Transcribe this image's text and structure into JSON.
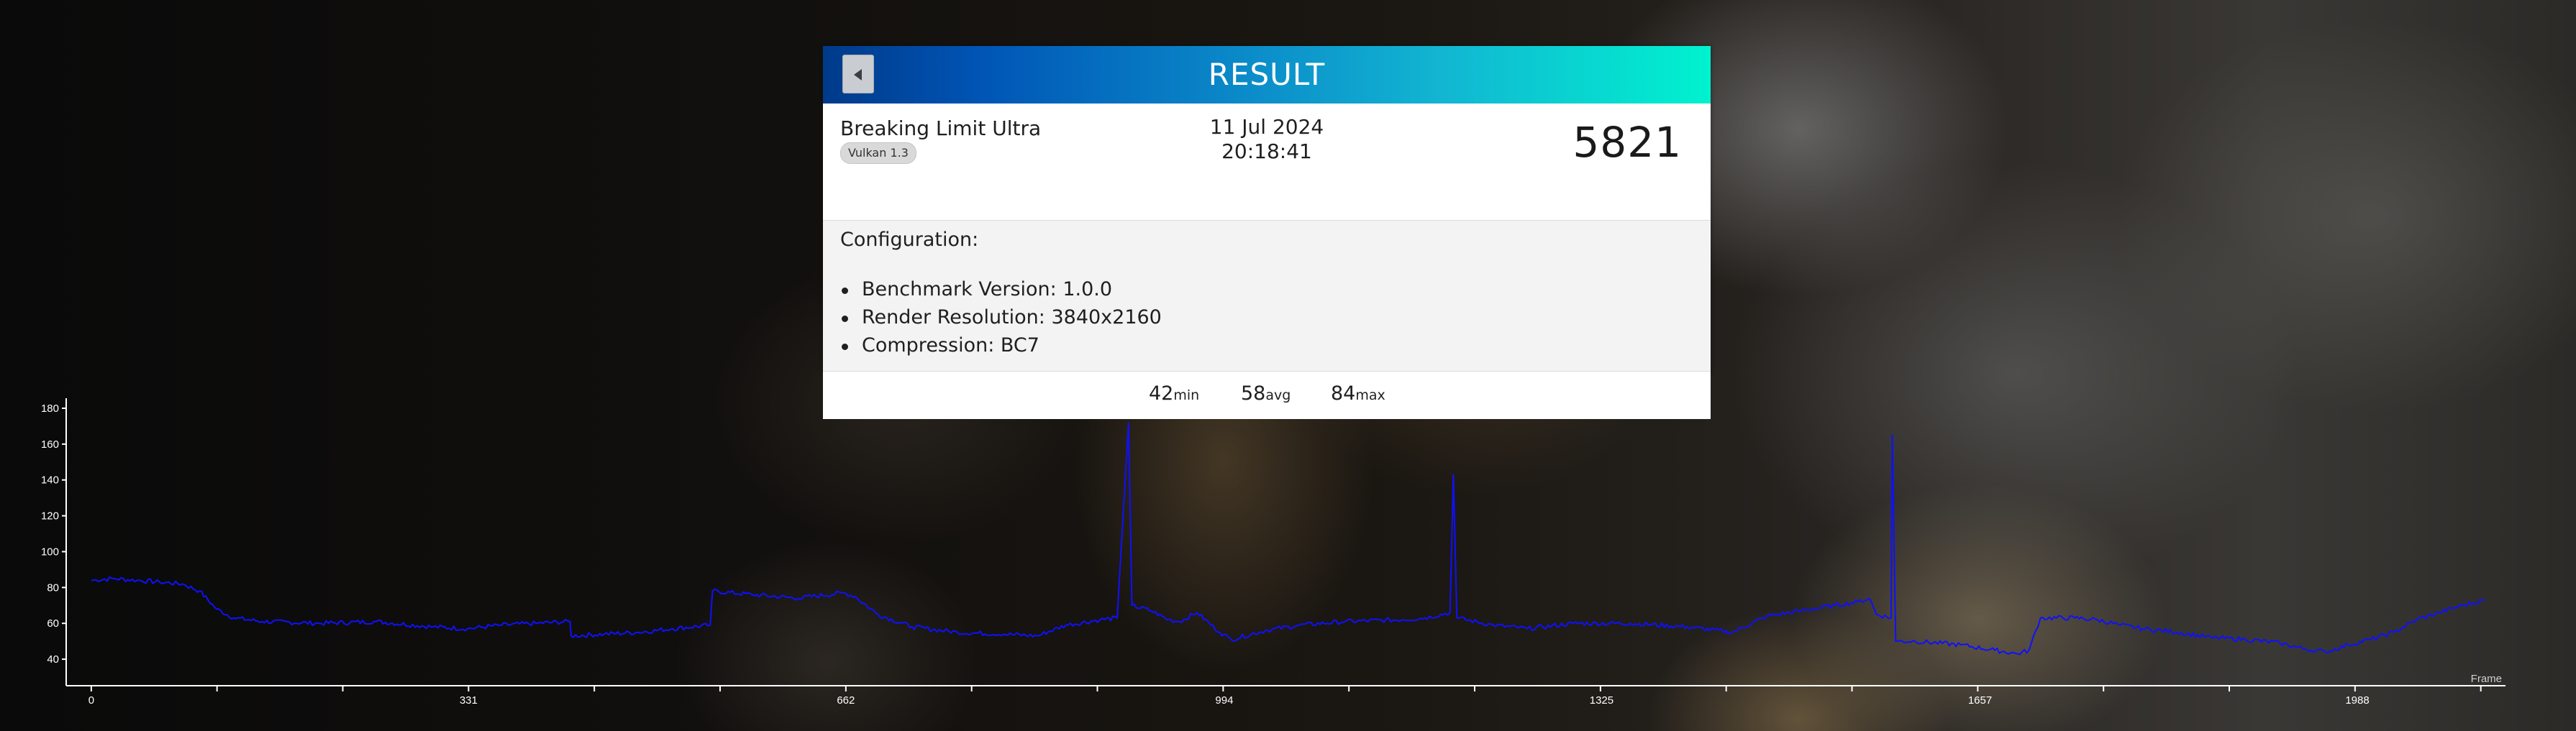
{
  "result_panel": {
    "title": "RESULT",
    "back_icon": "chevron-left-icon",
    "benchmark_name": "Breaking Limit Ultra",
    "api_badge": "Vulkan 1.3",
    "date": "11 Jul 2024",
    "time": "20:18:41",
    "score": "5821",
    "configuration": {
      "heading": "Configuration:",
      "items": [
        "Benchmark Version: 1.0.0",
        "Render Resolution: 3840x2160",
        "Compression: BC7"
      ]
    },
    "stats": {
      "min_value": "42",
      "min_label": "min",
      "avg_value": "58",
      "avg_label": "avg",
      "max_value": "84",
      "max_label": "max"
    },
    "colors": {
      "header_gradient_start": "#003a8a",
      "header_gradient_end": "#00f2cf",
      "series_color": "#1010ff"
    }
  },
  "chart_data": {
    "type": "line",
    "xlabel": "Frame",
    "ylabel": "",
    "x_ticks": [
      "0",
      "331",
      "662",
      "994",
      "1325",
      "1657",
      "1988"
    ],
    "y_ticks": [
      "40",
      "60",
      "80",
      "100",
      "120",
      "140",
      "160",
      "180"
    ],
    "xlim": [
      -22,
      2118
    ],
    "ylim": [
      26,
      184
    ],
    "grid": false,
    "series": [
      {
        "values_at_frames": [
          [
            0,
            84
          ],
          [
            20,
            85
          ],
          [
            40,
            84
          ],
          [
            60,
            83
          ],
          [
            80,
            82
          ],
          [
            95,
            78
          ],
          [
            110,
            68
          ],
          [
            125,
            63
          ],
          [
            150,
            61
          ],
          [
            200,
            60
          ],
          [
            250,
            61
          ],
          [
            300,
            58
          ],
          [
            330,
            57
          ],
          [
            360,
            59
          ],
          [
            390,
            60
          ],
          [
            420,
            61
          ],
          [
            421,
            53
          ],
          [
            450,
            54
          ],
          [
            480,
            55
          ],
          [
            510,
            57
          ],
          [
            543,
            59
          ],
          [
            545,
            78
          ],
          [
            580,
            76
          ],
          [
            620,
            74
          ],
          [
            660,
            77
          ],
          [
            670,
            75
          ],
          [
            690,
            65
          ],
          [
            720,
            58
          ],
          [
            760,
            55
          ],
          [
            800,
            54
          ],
          [
            830,
            53
          ],
          [
            855,
            59
          ],
          [
            885,
            62
          ],
          [
            900,
            63
          ],
          [
            910,
            172
          ],
          [
            913,
            70
          ],
          [
            930,
            67
          ],
          [
            945,
            62
          ],
          [
            955,
            61
          ],
          [
            970,
            66
          ],
          [
            990,
            55
          ],
          [
            1000,
            51
          ],
          [
            1030,
            56
          ],
          [
            1060,
            59
          ],
          [
            1100,
            61
          ],
          [
            1150,
            62
          ],
          [
            1170,
            63
          ],
          [
            1192,
            66
          ],
          [
            1195,
            143
          ],
          [
            1198,
            63
          ],
          [
            1230,
            59
          ],
          [
            1260,
            57
          ],
          [
            1300,
            60
          ],
          [
            1350,
            60
          ],
          [
            1400,
            58
          ],
          [
            1440,
            55
          ],
          [
            1470,
            64
          ],
          [
            1500,
            67
          ],
          [
            1530,
            70
          ],
          [
            1550,
            72
          ],
          [
            1560,
            74
          ],
          [
            1566,
            65
          ],
          [
            1579,
            63
          ],
          [
            1580,
            165
          ],
          [
            1583,
            50
          ],
          [
            1600,
            50
          ],
          [
            1640,
            48
          ],
          [
            1670,
            45
          ],
          [
            1690,
            43
          ],
          [
            1700,
            45
          ],
          [
            1710,
            63
          ],
          [
            1740,
            63
          ],
          [
            1760,
            62
          ],
          [
            1780,
            59
          ],
          [
            1800,
            57
          ],
          [
            1830,
            55
          ],
          [
            1860,
            52
          ],
          [
            1890,
            51
          ],
          [
            1920,
            49
          ],
          [
            1940,
            46
          ],
          [
            1960,
            44
          ],
          [
            1980,
            48
          ],
          [
            2000,
            51
          ],
          [
            2020,
            55
          ],
          [
            2040,
            62
          ],
          [
            2060,
            66
          ],
          [
            2080,
            70
          ],
          [
            2100,
            73
          ]
        ]
      }
    ]
  }
}
